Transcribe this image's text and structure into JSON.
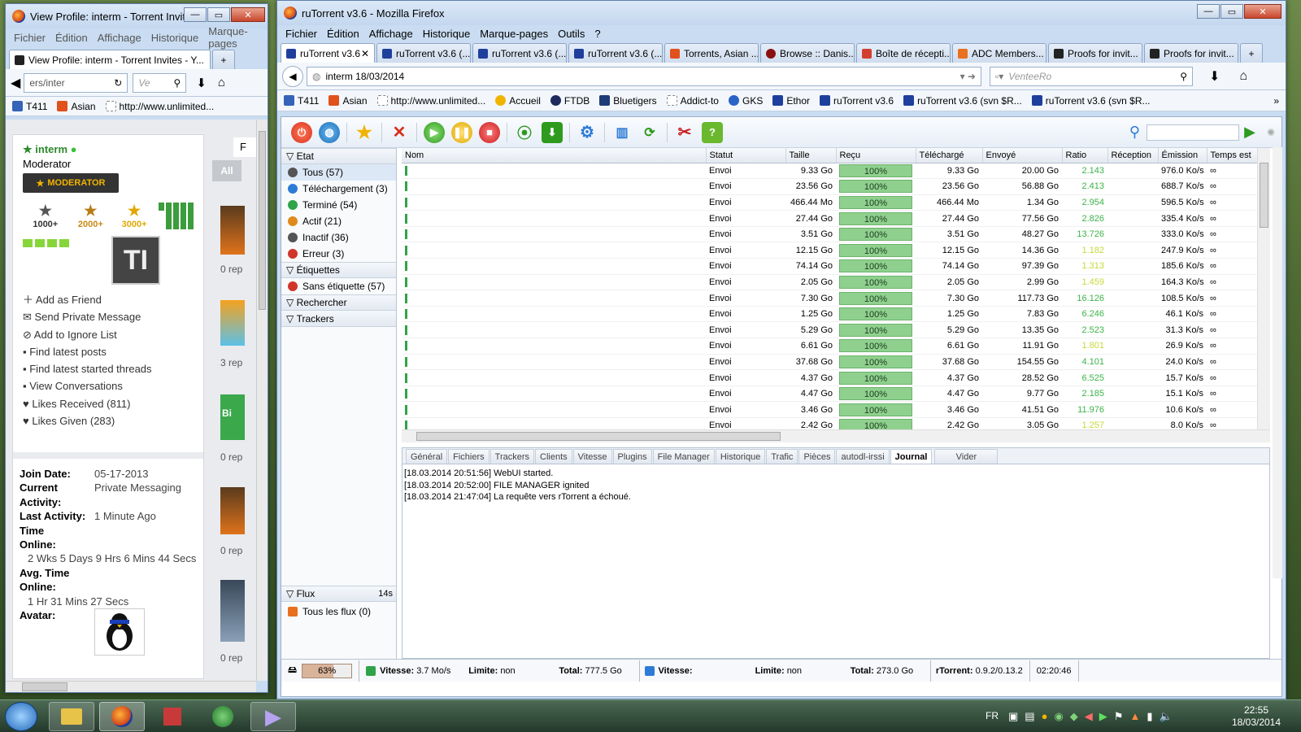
{
  "left_window": {
    "title": "View Profile: interm - Torrent Invit...",
    "menu": [
      "Fichier",
      "Édition",
      "Affichage",
      "Historique",
      "Marque-pages"
    ],
    "tab_label": "View Profile: interm - Torrent Invites - Y...",
    "url": "ers/inter",
    "search_placeholder": "Ve",
    "bookmarks": [
      "T411",
      "Asian",
      "http://www.unlimited..."
    ],
    "profile": {
      "username": "interm",
      "role": "Moderator",
      "badge": "MODERATOR",
      "post_badges": [
        "1000+",
        "2000+",
        "3000+"
      ],
      "avatar_letters": "TI",
      "actions": [
        "Add as Friend",
        "Send Private Message",
        "Add to Ignore List",
        "Find latest posts",
        "Find latest started threads",
        "View Conversations",
        "Likes Received (811)",
        "Likes Given (283)"
      ],
      "join_date_label": "Join Date:",
      "join_date": "05-17-2013",
      "current_activity_label": "Current Activity:",
      "current_activity": "Private Messaging",
      "last_activity_label": "Last Activity:",
      "last_activity": "1 Minute Ago",
      "time_online_label": "Time Online:",
      "time_online": "2 Wks 5 Days 9 Hrs 6 Mins 44 Secs",
      "avg_time_label": "Avg. Time Online:",
      "avg_time": "1 Hr 31 Mins 27 Secs",
      "avatar_label": "Avatar:"
    },
    "right_col": {
      "tab_all": "All",
      "tab_f": "F",
      "replies": [
        "0 rep",
        "3 rep",
        "0 rep",
        "0 rep",
        "0 rep"
      ]
    }
  },
  "main_window": {
    "title": "ruTorrent v3.6 - Mozilla Firefox",
    "menu": [
      "Fichier",
      "Édition",
      "Affichage",
      "Historique",
      "Marque-pages",
      "Outils",
      "?"
    ],
    "tabs": [
      "ruTorrent v3.6",
      "ruTorrent v3.6 (...",
      "ruTorrent v3.6 (...",
      "ruTorrent v3.6 (...",
      "Torrents, Asian ...",
      "Browse :: Danis...",
      "Boîte de récepti...",
      "ADC Members...",
      "Proofs for invit...",
      "Proofs for invit..."
    ],
    "new_tab": "+",
    "url": "interm 18/03/2014",
    "search_placeholder": "VenteeRo",
    "bookmarks": [
      "T411",
      "Asian",
      "http://www.unlimited...",
      "Accueil",
      "FTDB",
      "Bluetigers",
      "Addict-to",
      "GKS",
      "Ethor",
      "ruTorrent v3.6",
      "ruTorrent v3.6 (svn $R...",
      "ruTorrent v3.6 (svn $R..."
    ],
    "sidebar": {
      "etat_label": "Etat",
      "etat_items": [
        {
          "label": "Tous (57)",
          "color": "#555555"
        },
        {
          "label": "Téléchargement (3)",
          "color": "#2d7bd6"
        },
        {
          "label": "Terminé (54)",
          "color": "#2fa34a"
        },
        {
          "label": "Actif (21)",
          "color": "#e08a1e"
        },
        {
          "label": "Inactif (36)",
          "color": "#555555"
        },
        {
          "label": "Erreur (3)",
          "color": "#d0352a"
        }
      ],
      "etiquettes_label": "Étiquettes",
      "sans_etiquette": "Sans étiquette (57)",
      "rechercher_label": "Rechercher",
      "trackers_label": "Trackers",
      "flux_label": "Flux",
      "flux_time": "14s",
      "tous_flux": "Tous les flux (0)"
    },
    "table": {
      "columns": [
        "Nom",
        "Statut",
        "Taille",
        "Reçu",
        "Téléchargé",
        "Envoyé",
        "Ratio",
        "Réception",
        "Émission",
        "Temps est"
      ],
      "rows": [
        [
          "",
          "Envoi",
          "9.33 Go",
          "100%",
          "9.33 Go",
          "20.00 Go",
          "2.143",
          "",
          "976.0 Ko/s",
          "∞"
        ],
        [
          "",
          "Envoi",
          "23.56 Go",
          "100%",
          "23.56 Go",
          "56.88 Go",
          "2.413",
          "",
          "688.7 Ko/s",
          "∞"
        ],
        [
          "",
          "Envoi",
          "466.44 Mo",
          "100%",
          "466.44 Mo",
          "1.34 Go",
          "2.954",
          "",
          "596.5 Ko/s",
          "∞"
        ],
        [
          "",
          "Envoi",
          "27.44 Go",
          "100%",
          "27.44 Go",
          "77.56 Go",
          "2.826",
          "",
          "335.4 Ko/s",
          "∞"
        ],
        [
          "",
          "Envoi",
          "3.51 Go",
          "100%",
          "3.51 Go",
          "48.27 Go",
          "13.726",
          "",
          "333.0 Ko/s",
          "∞"
        ],
        [
          "",
          "Envoi",
          "12.15 Go",
          "100%",
          "12.15 Go",
          "14.36 Go",
          "1.182",
          "",
          "247.9 Ko/s",
          "∞"
        ],
        [
          "",
          "Envoi",
          "74.14 Go",
          "100%",
          "74.14 Go",
          "97.39 Go",
          "1.313",
          "",
          "185.6 Ko/s",
          "∞"
        ],
        [
          "",
          "Envoi",
          "2.05 Go",
          "100%",
          "2.05 Go",
          "2.99 Go",
          "1.459",
          "",
          "164.3 Ko/s",
          "∞"
        ],
        [
          "",
          "Envoi",
          "7.30 Go",
          "100%",
          "7.30 Go",
          "117.73 Go",
          "16.126",
          "",
          "108.5 Ko/s",
          "∞"
        ],
        [
          "",
          "Envoi",
          "1.25 Go",
          "100%",
          "1.25 Go",
          "7.83 Go",
          "6.246",
          "",
          "46.1 Ko/s",
          "∞"
        ],
        [
          "",
          "Envoi",
          "5.29 Go",
          "100%",
          "5.29 Go",
          "13.35 Go",
          "2.523",
          "",
          "31.3 Ko/s",
          "∞"
        ],
        [
          "",
          "Envoi",
          "6.61 Go",
          "100%",
          "6.61 Go",
          "11.91 Go",
          "1.801",
          "",
          "26.9 Ko/s",
          "∞"
        ],
        [
          "",
          "Envoi",
          "37.68 Go",
          "100%",
          "37.68 Go",
          "154.55 Go",
          "4.101",
          "",
          "24.0 Ko/s",
          "∞"
        ],
        [
          "",
          "Envoi",
          "4.37 Go",
          "100%",
          "4.37 Go",
          "28.52 Go",
          "6.525",
          "",
          "15.7 Ko/s",
          "∞"
        ],
        [
          "",
          "Envoi",
          "4.47 Go",
          "100%",
          "4.47 Go",
          "9.77 Go",
          "2.185",
          "",
          "15.1 Ko/s",
          "∞"
        ],
        [
          "",
          "Envoi",
          "3.46 Go",
          "100%",
          "3.46 Go",
          "41.51 Go",
          "11.976",
          "",
          "10.6 Ko/s",
          "∞"
        ],
        [
          "",
          "Envoi",
          "2.42 Go",
          "100%",
          "2.42 Go",
          "3.05 Go",
          "1.257",
          "",
          "8.0 Ko/s",
          "∞"
        ]
      ]
    },
    "bottom_tabs": [
      "Général",
      "Fichiers",
      "Trackers",
      "Clients",
      "Vitesse",
      "Plugins",
      "File Manager",
      "Historique",
      "Trafic",
      "Pièces",
      "autodl-irssi",
      "Journal",
      "Vider"
    ],
    "log": [
      "[18.03.2014 20:51:56] WebUI started.",
      "[18.03.2014 20:52:00] FILE MANAGER ignited",
      "[18.03.2014 21:47:04] La requête vers rTorrent a échoué."
    ],
    "status": {
      "disk": "63%",
      "dl_label": "Vitesse:",
      "dl_speed": "3.7 Mo/s",
      "dl_limit_label": "Limite:",
      "dl_limit": "non",
      "dl_total_label": "Total:",
      "dl_total": "777.5 Go",
      "ul_label": "Vitesse:",
      "ul_speed": "",
      "ul_limit_label": "Limite:",
      "ul_limit": "non",
      "ul_total_label": "Total:",
      "ul_total": "273.0 Go",
      "version_label": "rTorrent:",
      "version": "0.9.2/0.13.2",
      "uptime": "02:20:46"
    }
  },
  "taskbar": {
    "lang": "FR",
    "time": "22:55",
    "date": "18/03/2014"
  },
  "colors": {
    "progress": "#8fd08f",
    "ratio_good": "#3cb34a",
    "ratio_low": "#c7d93a"
  }
}
